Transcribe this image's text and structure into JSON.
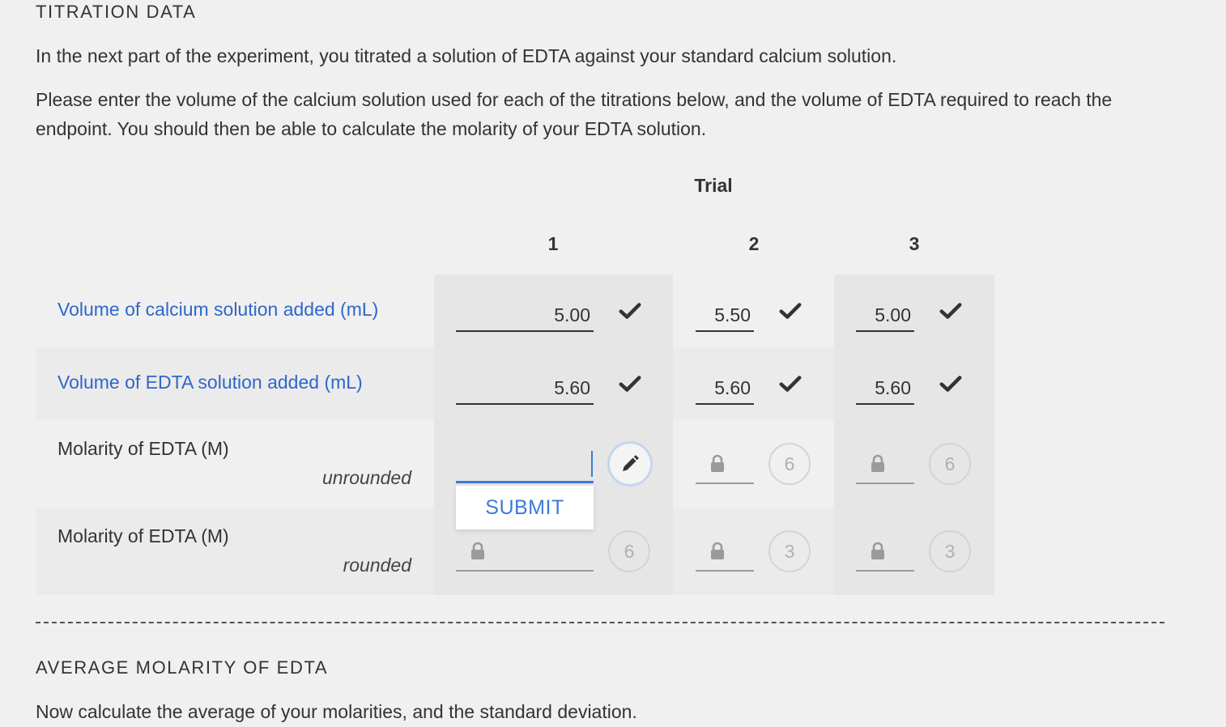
{
  "titration": {
    "heading": "TITRATION DATA",
    "intro": "In the next part of the experiment, you titrated a solution of EDTA against your standard calcium solution.",
    "instructions": "Please enter the volume of the calcium solution used for each of the titrations below, and the volume of EDTA required to reach the endpoint. You should then be able to calculate the molarity of your EDTA solution."
  },
  "table": {
    "trial_header": "Trial",
    "columns": [
      "1",
      "2",
      "3"
    ],
    "rows": {
      "calcium": {
        "label": "Volume of calcium solution added (mL)",
        "values": [
          "5.00",
          "5.50",
          "5.00"
        ]
      },
      "edta": {
        "label": "Volume of EDTA solution added (mL)",
        "values": [
          "5.60",
          "5.60",
          "5.60"
        ]
      },
      "molarity_unrounded": {
        "label": "Molarity of EDTA (M)",
        "sublabel": "unrounded",
        "value": "",
        "attempts": [
          "6",
          "6"
        ]
      },
      "molarity_rounded": {
        "label": "Molarity of EDTA (M)",
        "sublabel": "rounded",
        "attempts": [
          "6",
          "3",
          "3"
        ]
      }
    },
    "submit_label": "SUBMIT"
  },
  "average": {
    "heading": "AVERAGE MOLARITY OF EDTA",
    "intro": "Now calculate the average of your molarities, and the standard deviation."
  },
  "colors": {
    "link": "#2f66cc",
    "accent": "#3c7bd6",
    "background": "#f0f0f0"
  },
  "icons": {
    "correct": "check-icon",
    "locked": "lock-icon",
    "edit": "pencil-icon"
  }
}
